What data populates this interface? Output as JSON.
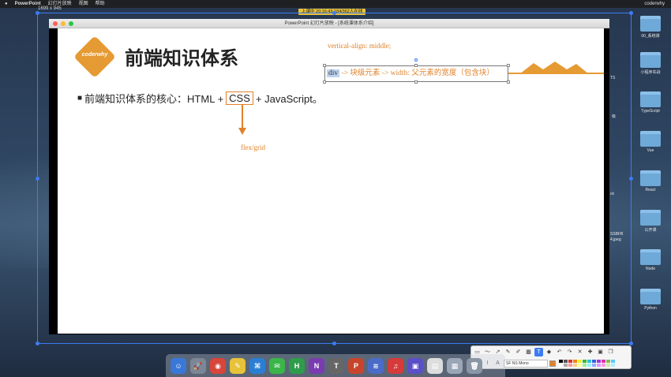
{
  "menubar": {
    "items": [
      "PowerPoint",
      "幻灯片放映",
      "视图",
      "帮助"
    ],
    "right": [
      "coderwhy"
    ]
  },
  "live_badge": "上课中 20:16:43 184/362人在线",
  "selection_size": "1699 x 945",
  "ppt_window": {
    "title": "PowerPoint 幻灯片放映 - [系统课体系介绍]"
  },
  "slide": {
    "logo_text": "coderwhy",
    "title": "前端知识体系",
    "note_top": "vertical-align: middle;",
    "note_box_selected": "div",
    "note_box_rest": " -> 块级元素 -> width: 父元素的宽度（包含块）",
    "bullet_prefix": "前端知识体系的核心：HTML + ",
    "bullet_css": "CSS",
    "bullet_suffix": "+ JavaScript。",
    "flex_note": "flex/grid"
  },
  "desktop_icons": [
    {
      "label": "00_系统课"
    },
    {
      "label": "小程序实战"
    },
    {
      "label": "TypeScript"
    },
    {
      "label": "Vue"
    },
    {
      "label": "React"
    },
    {
      "label": "公开课"
    },
    {
      "label": "Node"
    },
    {
      "label": "Python"
    }
  ],
  "partial_labels": [
    "TS",
    "级",
    "ck",
    "SSBFB",
    "4.jpeg"
  ],
  "annotation_toolbar": {
    "font": "SF NS Mono",
    "current_color": "#e0822a",
    "bold_label": "B",
    "italic_label": "I",
    "size_label": "A",
    "text_tool_label": "T"
  },
  "dock_apps": [
    {
      "name": "finder",
      "glyph": "☺",
      "color": "#3a78d8"
    },
    {
      "name": "launchpad",
      "glyph": "🚀",
      "color": "#7c8796"
    },
    {
      "name": "chrome",
      "glyph": "◉",
      "color": "#d8453a"
    },
    {
      "name": "notes",
      "glyph": "✎",
      "color": "#e8c33a"
    },
    {
      "name": "vscode",
      "glyph": "⌘",
      "color": "#2a7fd4"
    },
    {
      "name": "wechat",
      "glyph": "✉",
      "color": "#3bb54a"
    },
    {
      "name": "hbuilder",
      "glyph": "H",
      "color": "#2e9c4c"
    },
    {
      "name": "onenote",
      "glyph": "N",
      "color": "#7a3bb0"
    },
    {
      "name": "typora",
      "glyph": "T",
      "color": "#666666"
    },
    {
      "name": "powerpoint",
      "glyph": "P",
      "color": "#c8452c"
    },
    {
      "name": "editor",
      "glyph": "≋",
      "color": "#4a6cc8"
    },
    {
      "name": "netease-music",
      "glyph": "♫",
      "color": "#d63a3a"
    },
    {
      "name": "screen-tool",
      "glyph": "▣",
      "color": "#5a4fc8"
    },
    {
      "name": "document",
      "glyph": "▤",
      "color": "#dddddd"
    },
    {
      "name": "preview",
      "glyph": "▦",
      "color": "#9aa5b5"
    },
    {
      "name": "trash",
      "glyph": "🗑",
      "color": "#8a96a6"
    }
  ]
}
